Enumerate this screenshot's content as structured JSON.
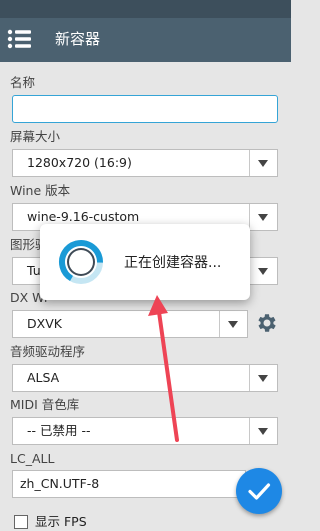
{
  "app_bar": {
    "title": "新容器",
    "menu_icon": "menu-icon"
  },
  "form": {
    "name": {
      "label": "名称",
      "value": ""
    },
    "screen_size": {
      "label": "屏幕大小",
      "value": "1280x720 (16:9)"
    },
    "wine_version": {
      "label": "Wine 版本",
      "value": "wine-9.16-custom"
    },
    "graphics_driver": {
      "label": "图形驱",
      "value": "Tu"
    },
    "dx_wrapper": {
      "label": "DX Wr",
      "value": "DXVK"
    },
    "audio_driver": {
      "label": "音频驱动程序",
      "value": "ALSA"
    },
    "midi": {
      "label": "MIDI 音色库",
      "value": "-- 已禁用 --"
    },
    "lc_all": {
      "label": "LC_ALL",
      "value": "zh_CN.UTF-8"
    },
    "show_fps": {
      "label": "显示 FPS",
      "checked": false
    }
  },
  "dialog": {
    "message": "正在创建容器..."
  },
  "colors": {
    "status_bar": "#3d4f5c",
    "app_bar": "#4b6170",
    "fab": "#1e88e5",
    "focus": "#35a4d6",
    "annotation_arrow": "#ee4455"
  }
}
